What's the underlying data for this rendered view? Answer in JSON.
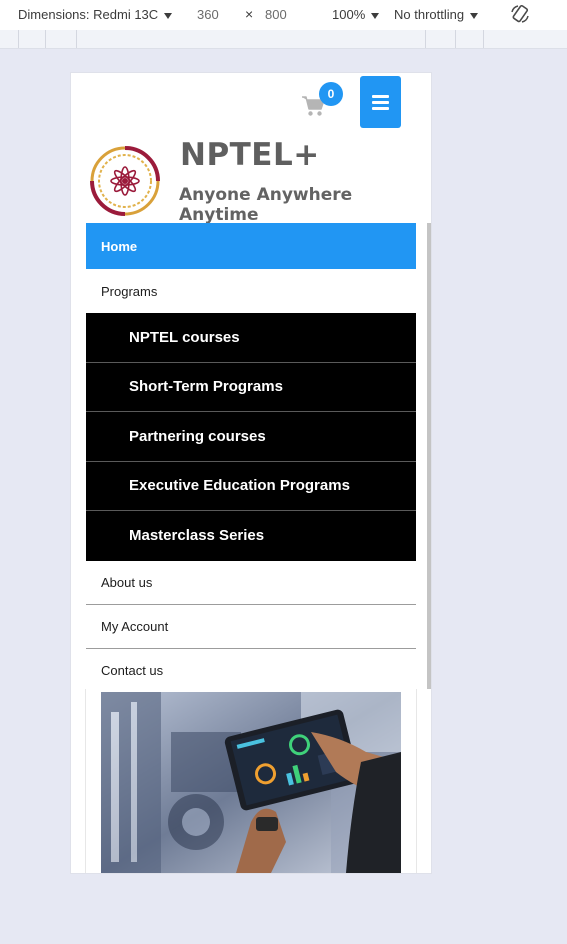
{
  "devtools": {
    "dimensions_label": "Dimensions: Redmi 13C",
    "width": "360",
    "times": "×",
    "height": "800",
    "zoom": "100%",
    "throttling": "No throttling"
  },
  "header": {
    "cart_count": "0",
    "brand_name": "NPTEL+",
    "tagline": "Anyone Anywhere Anytime",
    "accent_color": "#2196f3"
  },
  "nav": {
    "home": "Home",
    "programs": "Programs",
    "submenu": [
      {
        "label": "NPTEL courses"
      },
      {
        "label": "Short-Term Programs"
      },
      {
        "label": "Partnering courses"
      },
      {
        "label": "Executive Education Programs"
      },
      {
        "label": "Masterclass Series"
      }
    ],
    "about": "About us",
    "account": "My Account",
    "contact": "Contact us"
  },
  "icons": [
    "caret-down-icon",
    "rotate-device-icon",
    "cart-icon",
    "hamburger-icon"
  ]
}
